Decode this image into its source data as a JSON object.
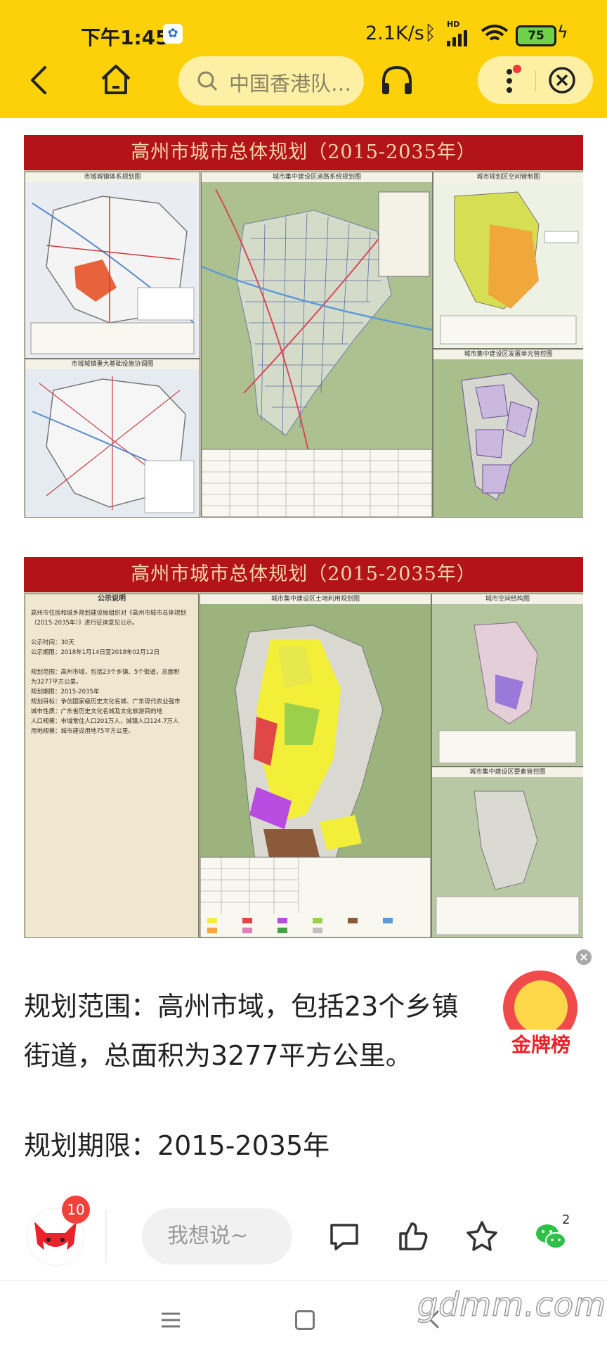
{
  "status_bar": {
    "time": "下午1:45",
    "net_speed": "2.1K/s",
    "battery": "75"
  },
  "nav": {
    "search_text": "中国香港队…"
  },
  "images": {
    "plan1_title": "高州市城市总体规划（2015-2035年）",
    "plan1_panels": {
      "p1": "市域城镇体系规划图",
      "p2": "城市集中建设区道路系统规划图",
      "p3": "城市规划区空间管制图",
      "p4": "市域城镇重大基础设施协调图",
      "p5": "城市集中建设区发展单元管控图"
    },
    "plan2_title": "高州市城市总体规划（2015-2035年）",
    "plan2_panels": {
      "p1": "公示说明",
      "p2": "城市集中建设区土地利用规划图",
      "p3": "城市空间结构图",
      "p4": "城市集中建设区要素管控图"
    },
    "notice_text": "高州市住房和城乡规划建设局组织对《高州市城市总体规划\n（2015-2035年）》进行征询意见公示。\n\n公示时间：30天\n公示期限：2018年1月14日至2018年02月12日\n\n规划范围：高州市域，包括23个乡镇、5个街道，总面积\n为3277平方公里。\n规划期限：2015-2035年\n规划目标：争创国家级历史文化名城、广东现代农业强市\n城市性质：广东省历史文化名城及文化旅游目的地\n人口规模：市域常住人口201万人，城镇人口124.7万人\n用地规模：城市建设用地75平方公里。"
  },
  "article": {
    "para1": "规划范围：高州市域，包括23个乡镇",
    "para2": "街道，总面积为3277平方公里。",
    "para3": "规划期限：2015-2035年"
  },
  "medal_widget": {
    "label": "金牌榜"
  },
  "action_bar": {
    "avatar_badge": "10",
    "comment_placeholder": "我想说~",
    "wechat_count": "2"
  },
  "watermark": "gdmm.com"
}
